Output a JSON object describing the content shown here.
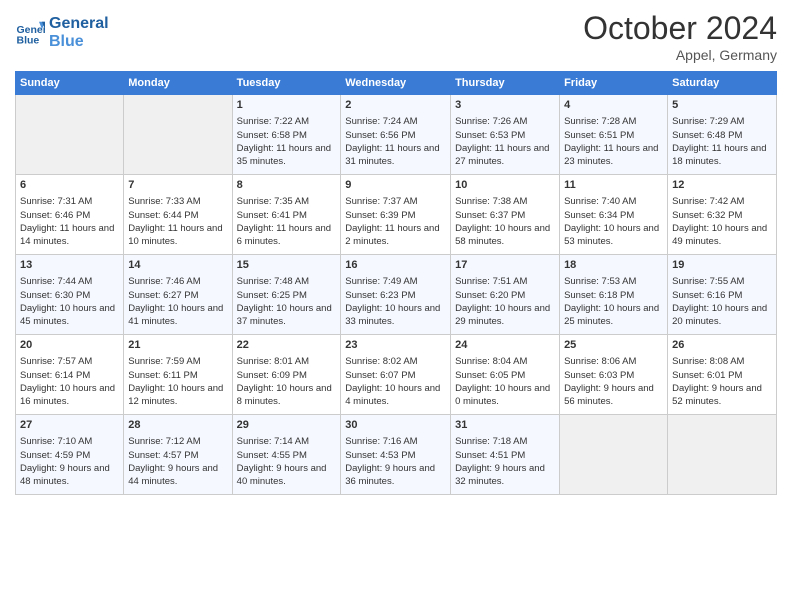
{
  "header": {
    "logo_line1": "General",
    "logo_line2": "Blue",
    "title": "October 2024",
    "location": "Appel, Germany"
  },
  "columns": [
    "Sunday",
    "Monday",
    "Tuesday",
    "Wednesday",
    "Thursday",
    "Friday",
    "Saturday"
  ],
  "weeks": [
    [
      {
        "day": "",
        "empty": true
      },
      {
        "day": "",
        "empty": true
      },
      {
        "day": "1",
        "sunrise": "Sunrise: 7:22 AM",
        "sunset": "Sunset: 6:58 PM",
        "daylight": "Daylight: 11 hours and 35 minutes."
      },
      {
        "day": "2",
        "sunrise": "Sunrise: 7:24 AM",
        "sunset": "Sunset: 6:56 PM",
        "daylight": "Daylight: 11 hours and 31 minutes."
      },
      {
        "day": "3",
        "sunrise": "Sunrise: 7:26 AM",
        "sunset": "Sunset: 6:53 PM",
        "daylight": "Daylight: 11 hours and 27 minutes."
      },
      {
        "day": "4",
        "sunrise": "Sunrise: 7:28 AM",
        "sunset": "Sunset: 6:51 PM",
        "daylight": "Daylight: 11 hours and 23 minutes."
      },
      {
        "day": "5",
        "sunrise": "Sunrise: 7:29 AM",
        "sunset": "Sunset: 6:48 PM",
        "daylight": "Daylight: 11 hours and 18 minutes."
      }
    ],
    [
      {
        "day": "6",
        "sunrise": "Sunrise: 7:31 AM",
        "sunset": "Sunset: 6:46 PM",
        "daylight": "Daylight: 11 hours and 14 minutes."
      },
      {
        "day": "7",
        "sunrise": "Sunrise: 7:33 AM",
        "sunset": "Sunset: 6:44 PM",
        "daylight": "Daylight: 11 hours and 10 minutes."
      },
      {
        "day": "8",
        "sunrise": "Sunrise: 7:35 AM",
        "sunset": "Sunset: 6:41 PM",
        "daylight": "Daylight: 11 hours and 6 minutes."
      },
      {
        "day": "9",
        "sunrise": "Sunrise: 7:37 AM",
        "sunset": "Sunset: 6:39 PM",
        "daylight": "Daylight: 11 hours and 2 minutes."
      },
      {
        "day": "10",
        "sunrise": "Sunrise: 7:38 AM",
        "sunset": "Sunset: 6:37 PM",
        "daylight": "Daylight: 10 hours and 58 minutes."
      },
      {
        "day": "11",
        "sunrise": "Sunrise: 7:40 AM",
        "sunset": "Sunset: 6:34 PM",
        "daylight": "Daylight: 10 hours and 53 minutes."
      },
      {
        "day": "12",
        "sunrise": "Sunrise: 7:42 AM",
        "sunset": "Sunset: 6:32 PM",
        "daylight": "Daylight: 10 hours and 49 minutes."
      }
    ],
    [
      {
        "day": "13",
        "sunrise": "Sunrise: 7:44 AM",
        "sunset": "Sunset: 6:30 PM",
        "daylight": "Daylight: 10 hours and 45 minutes."
      },
      {
        "day": "14",
        "sunrise": "Sunrise: 7:46 AM",
        "sunset": "Sunset: 6:27 PM",
        "daylight": "Daylight: 10 hours and 41 minutes."
      },
      {
        "day": "15",
        "sunrise": "Sunrise: 7:48 AM",
        "sunset": "Sunset: 6:25 PM",
        "daylight": "Daylight: 10 hours and 37 minutes."
      },
      {
        "day": "16",
        "sunrise": "Sunrise: 7:49 AM",
        "sunset": "Sunset: 6:23 PM",
        "daylight": "Daylight: 10 hours and 33 minutes."
      },
      {
        "day": "17",
        "sunrise": "Sunrise: 7:51 AM",
        "sunset": "Sunset: 6:20 PM",
        "daylight": "Daylight: 10 hours and 29 minutes."
      },
      {
        "day": "18",
        "sunrise": "Sunrise: 7:53 AM",
        "sunset": "Sunset: 6:18 PM",
        "daylight": "Daylight: 10 hours and 25 minutes."
      },
      {
        "day": "19",
        "sunrise": "Sunrise: 7:55 AM",
        "sunset": "Sunset: 6:16 PM",
        "daylight": "Daylight: 10 hours and 20 minutes."
      }
    ],
    [
      {
        "day": "20",
        "sunrise": "Sunrise: 7:57 AM",
        "sunset": "Sunset: 6:14 PM",
        "daylight": "Daylight: 10 hours and 16 minutes."
      },
      {
        "day": "21",
        "sunrise": "Sunrise: 7:59 AM",
        "sunset": "Sunset: 6:11 PM",
        "daylight": "Daylight: 10 hours and 12 minutes."
      },
      {
        "day": "22",
        "sunrise": "Sunrise: 8:01 AM",
        "sunset": "Sunset: 6:09 PM",
        "daylight": "Daylight: 10 hours and 8 minutes."
      },
      {
        "day": "23",
        "sunrise": "Sunrise: 8:02 AM",
        "sunset": "Sunset: 6:07 PM",
        "daylight": "Daylight: 10 hours and 4 minutes."
      },
      {
        "day": "24",
        "sunrise": "Sunrise: 8:04 AM",
        "sunset": "Sunset: 6:05 PM",
        "daylight": "Daylight: 10 hours and 0 minutes."
      },
      {
        "day": "25",
        "sunrise": "Sunrise: 8:06 AM",
        "sunset": "Sunset: 6:03 PM",
        "daylight": "Daylight: 9 hours and 56 minutes."
      },
      {
        "day": "26",
        "sunrise": "Sunrise: 8:08 AM",
        "sunset": "Sunset: 6:01 PM",
        "daylight": "Daylight: 9 hours and 52 minutes."
      }
    ],
    [
      {
        "day": "27",
        "sunrise": "Sunrise: 7:10 AM",
        "sunset": "Sunset: 4:59 PM",
        "daylight": "Daylight: 9 hours and 48 minutes."
      },
      {
        "day": "28",
        "sunrise": "Sunrise: 7:12 AM",
        "sunset": "Sunset: 4:57 PM",
        "daylight": "Daylight: 9 hours and 44 minutes."
      },
      {
        "day": "29",
        "sunrise": "Sunrise: 7:14 AM",
        "sunset": "Sunset: 4:55 PM",
        "daylight": "Daylight: 9 hours and 40 minutes."
      },
      {
        "day": "30",
        "sunrise": "Sunrise: 7:16 AM",
        "sunset": "Sunset: 4:53 PM",
        "daylight": "Daylight: 9 hours and 36 minutes."
      },
      {
        "day": "31",
        "sunrise": "Sunrise: 7:18 AM",
        "sunset": "Sunset: 4:51 PM",
        "daylight": "Daylight: 9 hours and 32 minutes."
      },
      {
        "day": "",
        "empty": true
      },
      {
        "day": "",
        "empty": true
      }
    ]
  ]
}
